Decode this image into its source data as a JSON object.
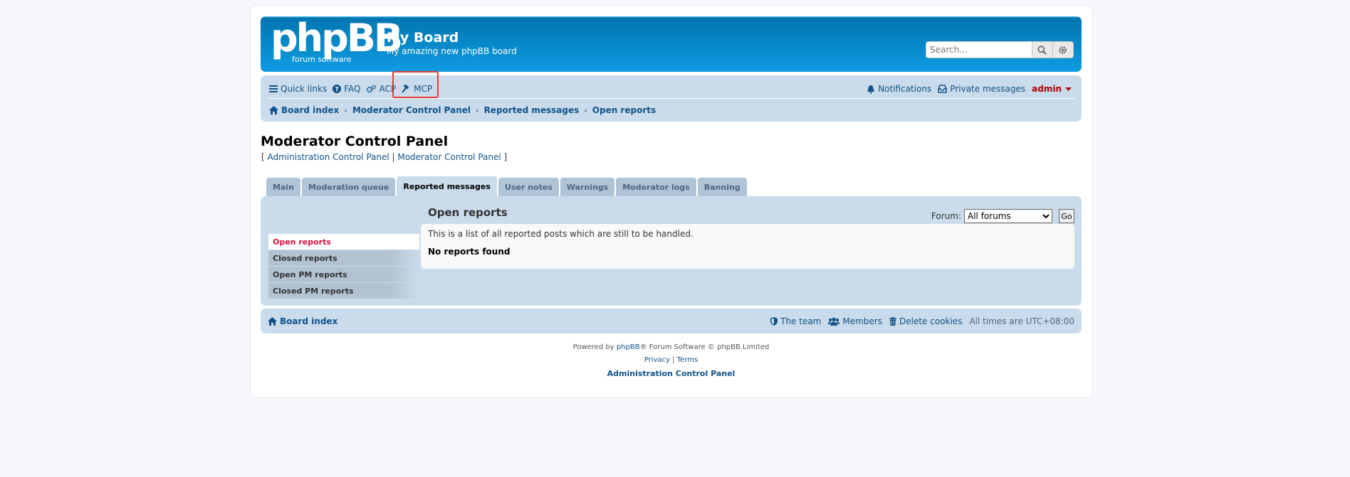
{
  "header": {
    "logo_main": "phpBB",
    "logo_sub": "forum software",
    "site_title": "My Board",
    "site_description": "My amazing new phpBB board",
    "search_placeholder": "Search…"
  },
  "nav": {
    "quick_links": "Quick links",
    "faq": "FAQ",
    "acp": "ACP",
    "mcp": "MCP",
    "notifications": "Notifications",
    "private_messages": "Private messages",
    "username": "admin"
  },
  "breadcrumbs": [
    "Board index",
    "Moderator Control Panel",
    "Reported messages",
    "Open reports"
  ],
  "page": {
    "title": "Moderator Control Panel",
    "link_open": "[ ",
    "link_acp": "Administration Control Panel",
    "link_sep": " | ",
    "link_mcp": "Moderator Control Panel",
    "link_close": " ]"
  },
  "tabs": [
    "Main",
    "Moderation queue",
    "Reported messages",
    "User notes",
    "Warnings",
    "Moderator logs",
    "Banning"
  ],
  "side_menu": [
    "Open reports",
    "Closed reports",
    "Open PM reports",
    "Closed PM reports"
  ],
  "panel": {
    "title": "Open reports",
    "forum_label": "Forum:",
    "forum_selected": "All forums",
    "go_button": "Go",
    "description": "This is a list of all reported posts which are still to be handled.",
    "empty_message": "No reports found"
  },
  "footer_nav": {
    "board_index": "Board index",
    "team": "The team",
    "members": "Members",
    "delete_cookies": "Delete cookies",
    "timezone_label": "All times are",
    "timezone_value": "UTC+08:00"
  },
  "copyright": {
    "powered_by": "Powered by",
    "phpbb": "phpBB",
    "suffix": "® Forum Software © phpBB Limited",
    "privacy": "Privacy",
    "sep": " | ",
    "terms": "Terms",
    "acp": "Administration Control Panel"
  },
  "colors": {
    "header_blue": "#12a3eb",
    "nav_bg": "#cadceb",
    "link": "#105289",
    "username": "#aa0000",
    "active_side": "#d31141",
    "highlight": "#e53935"
  }
}
